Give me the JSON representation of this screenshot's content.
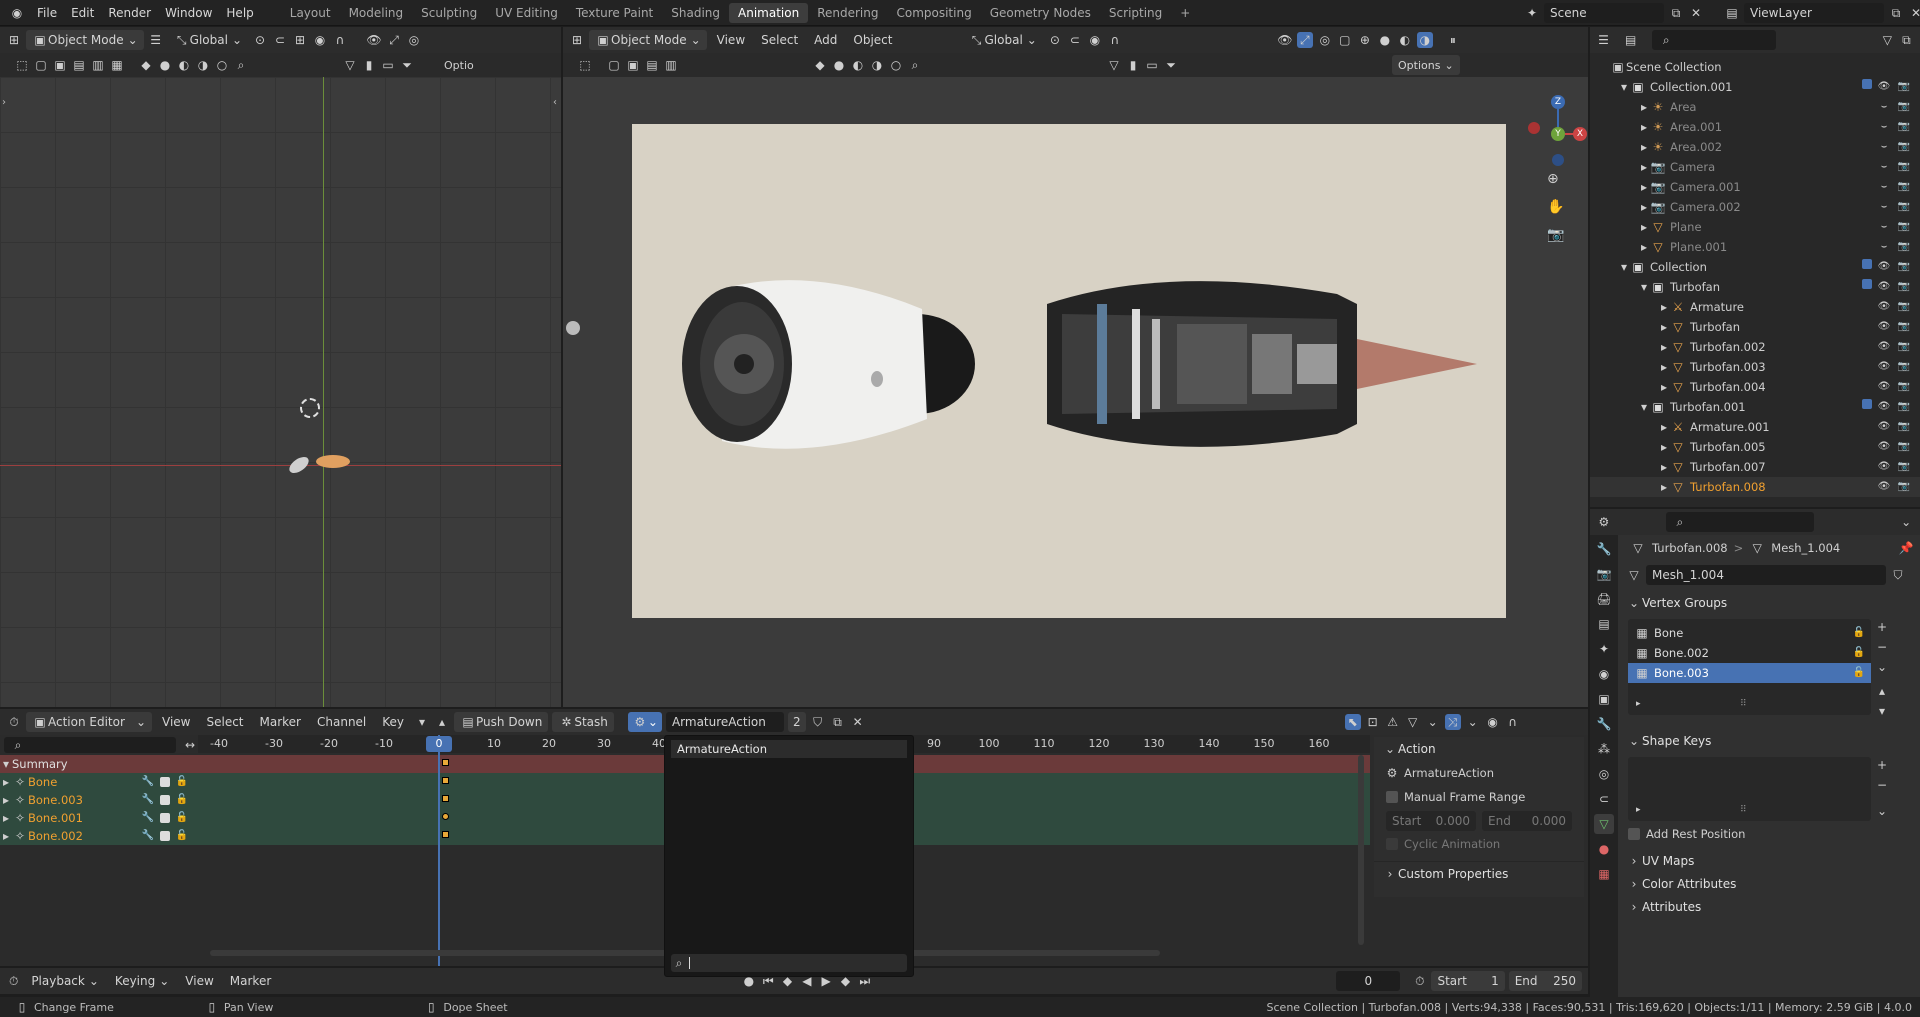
{
  "topbar": {
    "menus": [
      "File",
      "Edit",
      "Render",
      "Window",
      "Help"
    ],
    "workspaces": [
      "Layout",
      "Modeling",
      "Sculpting",
      "UV Editing",
      "Texture Paint",
      "Shading",
      "Animation",
      "Rendering",
      "Compositing",
      "Geometry Nodes",
      "Scripting"
    ],
    "active_workspace": "Animation",
    "add_tab": "+",
    "scene": "Scene",
    "view_layer": "ViewLayer"
  },
  "left_view": {
    "mode": "Object Mode",
    "orientation": "Global",
    "options": "Optio"
  },
  "camera_view": {
    "mode": "Object Mode",
    "menus": [
      "View",
      "Select",
      "Add",
      "Object"
    ],
    "orientation": "Global",
    "options": "Options",
    "gizmo": {
      "z": "Z",
      "y": "Y",
      "x": "X"
    }
  },
  "outliner": {
    "root": "Scene Collection",
    "rows": [
      {
        "label": "Collection.001",
        "indent": 1,
        "kind": "collection",
        "check": true,
        "bright": true
      },
      {
        "label": "Area",
        "indent": 2,
        "kind": "light",
        "dim": true
      },
      {
        "label": "Area.001",
        "indent": 2,
        "kind": "light",
        "dim": true
      },
      {
        "label": "Area.002",
        "indent": 2,
        "kind": "light",
        "dim": true
      },
      {
        "label": "Camera",
        "indent": 2,
        "kind": "camera",
        "dim": true
      },
      {
        "label": "Camera.001",
        "indent": 2,
        "kind": "camera",
        "dim": true
      },
      {
        "label": "Camera.002",
        "indent": 2,
        "kind": "camera",
        "dim": true
      },
      {
        "label": "Plane",
        "indent": 2,
        "kind": "mesh",
        "dim": true
      },
      {
        "label": "Plane.001",
        "indent": 2,
        "kind": "mesh",
        "dim": true
      },
      {
        "label": "Collection",
        "indent": 1,
        "kind": "collection",
        "check": true,
        "bright": true
      },
      {
        "label": "Turbofan",
        "indent": 2,
        "kind": "collection",
        "check": true,
        "bright": true
      },
      {
        "label": "Armature",
        "indent": 3,
        "kind": "armature",
        "bright": true
      },
      {
        "label": "Turbofan",
        "indent": 3,
        "kind": "mesh",
        "bright": true
      },
      {
        "label": "Turbofan.002",
        "indent": 3,
        "kind": "mesh",
        "bright": true
      },
      {
        "label": "Turbofan.003",
        "indent": 3,
        "kind": "mesh",
        "bright": true
      },
      {
        "label": "Turbofan.004",
        "indent": 3,
        "kind": "mesh",
        "bright": true
      },
      {
        "label": "Turbofan.001",
        "indent": 2,
        "kind": "collection",
        "check": true,
        "bright": true
      },
      {
        "label": "Armature.001",
        "indent": 3,
        "kind": "armature",
        "bright": true
      },
      {
        "label": "Turbofan.005",
        "indent": 3,
        "kind": "mesh",
        "bright": true
      },
      {
        "label": "Turbofan.007",
        "indent": 3,
        "kind": "mesh",
        "bright": true
      },
      {
        "label": "Turbofan.008",
        "indent": 3,
        "kind": "mesh",
        "bright": true,
        "selected": true
      }
    ]
  },
  "properties": {
    "breadcrumb_object": "Turbofan.008",
    "breadcrumb_sep": ">",
    "breadcrumb_data": "Mesh_1.004",
    "mesh_name": "Mesh_1.004",
    "vertex_groups_title": "Vertex Groups",
    "vertex_groups": [
      "Bone",
      "Bone.002",
      "Bone.003"
    ],
    "active_vertex_group": "Bone.003",
    "shape_keys_title": "Shape Keys",
    "add_rest_position": "Add Rest Position",
    "uv_maps": "UV Maps",
    "color_attributes": "Color Attributes",
    "attributes": "Attributes"
  },
  "action_editor": {
    "editor_mode": "Action Editor",
    "menus": [
      "View",
      "Select",
      "Marker",
      "Channel",
      "Key"
    ],
    "push_down": "Push Down",
    "stash": "Stash",
    "action_name": "ArmatureAction",
    "users": "2",
    "ticks": [
      "-40",
      "-30",
      "-20",
      "-10",
      "0",
      "10",
      "20",
      "30",
      "40",
      "90",
      "100",
      "110",
      "120",
      "130",
      "140",
      "150",
      "160"
    ],
    "current_frame": "0",
    "channels": [
      "Summary",
      "Bone",
      "Bone.003",
      "Bone.001",
      "Bone.002"
    ],
    "dropdown_item": "ArmatureAction",
    "side_panel": {
      "title": "Action",
      "action": "ArmatureAction",
      "manual_range": "Manual Frame Range",
      "start_label": "Start",
      "start_value": "0.000",
      "end_label": "End",
      "end_value": "0.000",
      "cyclic": "Cyclic Animation",
      "custom_props": "Custom Properties"
    }
  },
  "timeline": {
    "playback": "Playback",
    "keying": "Keying",
    "view": "View",
    "marker": "Marker",
    "frame": "0",
    "start_label": "Start",
    "start": "1",
    "end_label": "End",
    "end": "250"
  },
  "statusbar": {
    "hint1": "Change Frame",
    "hint2": "Pan View",
    "hint3": "Dope Sheet",
    "stats": "Scene Collection | Turbofan.008 | Verts:94,338 | Faces:90,531 | Tris:169,620 | Objects:1/11 | Memory: 2.59 GiB | 4.0.0"
  },
  "colors": {
    "accent": "#4772b3",
    "keyframe": "#e8a838",
    "selected_text": "#f0a030"
  }
}
